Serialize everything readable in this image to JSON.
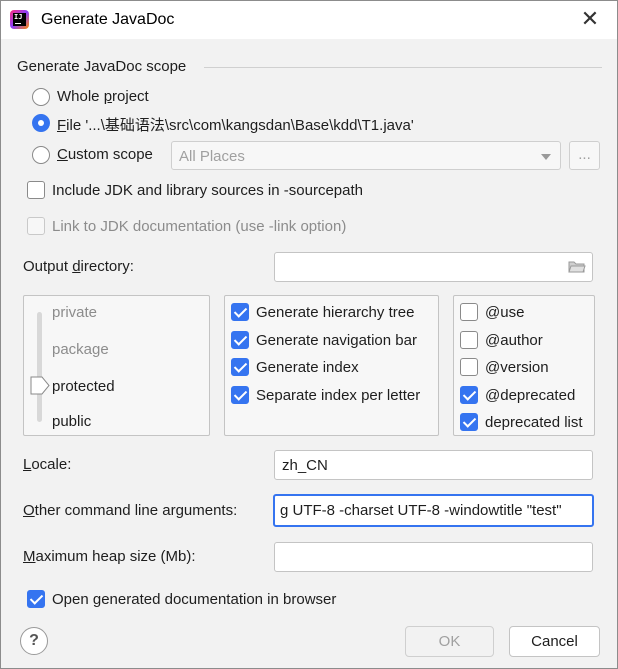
{
  "window": {
    "title": "Generate JavaDoc",
    "close_glyph": "✕"
  },
  "scope": {
    "group_title": "Generate JavaDoc scope",
    "options": [
      {
        "pre": "Whole ",
        "mn": "p",
        "post": "roject",
        "selected": false
      },
      {
        "pre": "",
        "mn": "F",
        "post": "ile '...\\基础语法\\src\\com\\kangsdan\\Base\\kdd\\T1.java'",
        "selected": true
      },
      {
        "pre": "",
        "mn": "C",
        "post": "ustom scope",
        "selected": false
      }
    ],
    "custom_scope_value": "All Places",
    "ellipsis_label": "..."
  },
  "include_jdk": {
    "label": "Include JDK and library sources in -sourcepath",
    "checked": false
  },
  "link_jdk": {
    "label": "Link to JDK documentation (use -link option)",
    "checked": false,
    "enabled": false
  },
  "output_dir": {
    "pre": "Output ",
    "mn": "d",
    "post": "irectory:",
    "value": ""
  },
  "visibility": {
    "levels": [
      "private",
      "package",
      "protected",
      "public"
    ],
    "selected": "protected"
  },
  "generate_options": [
    {
      "label": "Generate hierarchy tree",
      "checked": true
    },
    {
      "label": "Generate navigation bar",
      "checked": true
    },
    {
      "label": "Generate index",
      "checked": true
    },
    {
      "label": "Separate index per letter",
      "checked": true
    }
  ],
  "tag_options": [
    {
      "label": "@use",
      "checked": false
    },
    {
      "label": "@author",
      "checked": false
    },
    {
      "label": "@version",
      "checked": false
    },
    {
      "label": "@deprecated",
      "checked": true
    },
    {
      "label": "deprecated list",
      "checked": true
    }
  ],
  "locale": {
    "pre": "",
    "mn": "L",
    "post": "ocale:",
    "value": "zh_CN"
  },
  "other_args": {
    "pre": "",
    "mn": "O",
    "post": "ther command line arguments:",
    "value": "g UTF-8 -charset UTF-8 -windowtitle \"test\""
  },
  "max_heap": {
    "pre": "",
    "mn": "M",
    "post": "aximum heap size (Mb):",
    "value": ""
  },
  "open_browser": {
    "pre": "Open ",
    "mn": "g",
    "post": "enerated documentation in browser",
    "checked": true
  },
  "buttons": {
    "help": "?",
    "ok": "OK",
    "cancel": "Cancel"
  },
  "colors": {
    "accent": "#3574f0",
    "background": "#f2f2f2"
  }
}
